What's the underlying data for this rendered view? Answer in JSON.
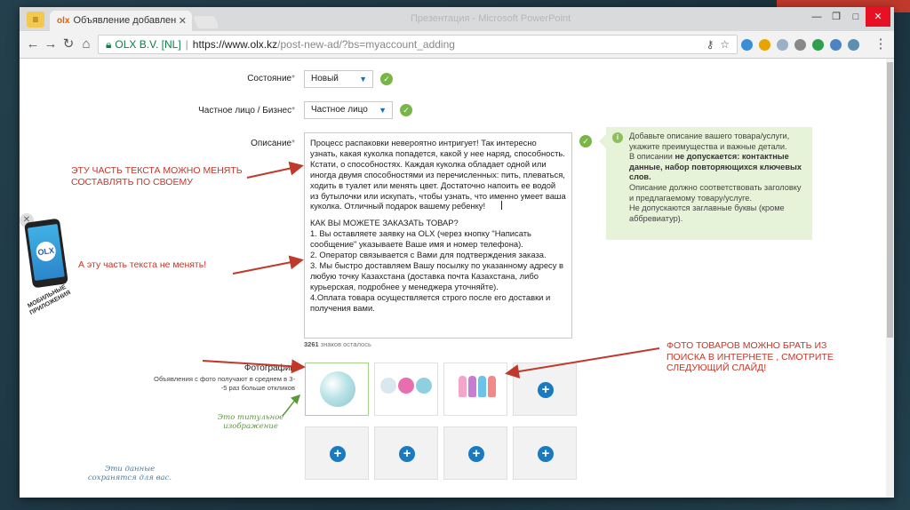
{
  "browser": {
    "tab_title": "Объявление добавлен",
    "tab_favicon": "olx",
    "window_title": "Презентация - Microsoft PowerPoint",
    "url_secure_label": "OLX B.V. [NL]",
    "url_host": "https://www.olx.kz",
    "url_path": "/post-new-ad/?bs=myaccount_adding"
  },
  "form": {
    "state_label": "Состояние",
    "state_value": "Новый",
    "seller_label": "Частное лицо / Бизнес",
    "seller_value": "Частное лицо",
    "description_label": "Описание",
    "description_p1": "Процесс распаковки невероятно интригует! Так интересно узнать, какая куколка попадется, какой у нее наряд, способность. Кстати, о способностях. Каждая куколка обладает одной или иногда двумя способностями из перечисленных: пить, плеваться, ходить в туалет или менять цвет. Достаточно напоить ее водой из бутылочки или искупать, чтобы узнать, что именно умеет ваша куколка. Отличный подарок вашему ребенку!",
    "description_p2": "КАК ВЫ МОЖЕТЕ ЗАКАЗАТЬ ТОВАР?",
    "description_p3": "1. Вы оставляете заявку на OLX (через кнопку \"Написать сообщение\" указываете Ваше имя и номер телефона).",
    "description_p4": "2. Оператор связывается с Вами для подтверждения заказа.",
    "description_p5": "3. Мы быстро доставляем Вашу посылку по указанному адресу в любую точку Казахстана (доставка почта Казахстана, либо курьерская, подробнее у менеджера уточняйте).",
    "description_p6": "4.Оплата товара осуществляется строго после его доставки и получения вами.",
    "counter_number": "3261",
    "counter_text": "знаков осталось",
    "photos_label": "Фотографии",
    "photos_sub": "Объявления с фото получают в среднем в 3--5 раз больше откликов"
  },
  "hint": {
    "line1": "Добавьте описание вашего товара/услуги, укажите преимущества и важные детали.",
    "line2_pre": "В описании ",
    "line2_bold": "не допускается: контактные данные, набор повторяющихся ключевых слов.",
    "line3": "Описание должно соответствовать заголовку и предлагаемому товару/услуге.",
    "line4": "Не допускаются заглавные буквы (кроме аббревиатур)."
  },
  "annotations": {
    "text_editable": "ЭТУ ЧАСТЬ ТЕКСТА МОЖНО МЕНЯТЬ\nСОСТАВЛЯТЬ ПО СВОЕМУ",
    "text_fixed": "А эту часть текста не менять!",
    "photos_source": "ФОТО ТОВАРОВ МОЖНО БРАТЬ ИЗ\nПОИСКА В ИНТЕРНЕТЕ , СМОТРИТЕ\nСЛЕДУЮЩИЙ СЛАЙД!",
    "title_photo": "Это титульное\nизображение",
    "saved_data": "Эти данные\nсохранятся для вас.",
    "mobile_apps": "МОБИЛЬНЫЕ\nПРИЛОЖЕНИЯ"
  },
  "colors": {
    "accent_green": "#7ab547",
    "accent_blue": "#1a7abf",
    "annotation_red": "#c0392b",
    "hint_bg": "#e6f3d8"
  }
}
